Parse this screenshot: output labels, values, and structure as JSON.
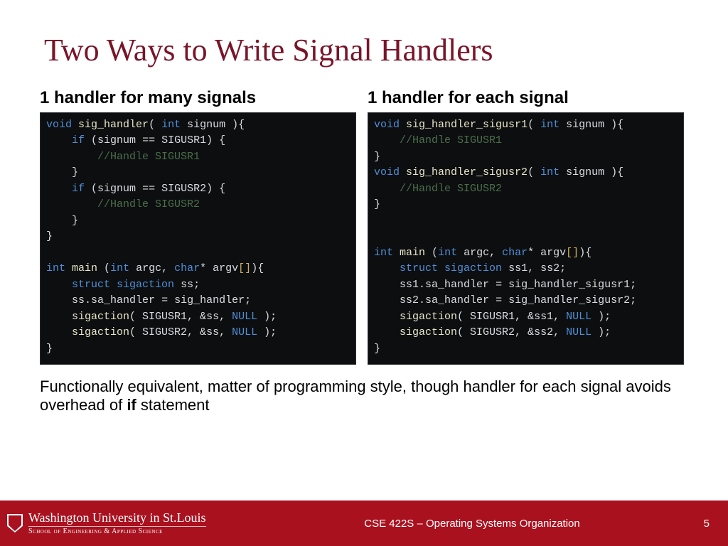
{
  "title": "Two Ways to Write Signal Handlers",
  "left": {
    "heading": "1 handler for many signals",
    "code": [
      {
        "t": "kw",
        "s": "void"
      },
      {
        "t": "pn",
        "s": " "
      },
      {
        "t": "fn",
        "s": "sig_handler"
      },
      {
        "t": "pn",
        "s": "( "
      },
      {
        "t": "kw",
        "s": "int"
      },
      {
        "t": "pn",
        "s": " "
      },
      {
        "t": "id",
        "s": "signum"
      },
      {
        "t": "pn",
        "s": " ){\n"
      },
      {
        "t": "pn",
        "s": "    "
      },
      {
        "t": "kw",
        "s": "if"
      },
      {
        "t": "pn",
        "s": " ("
      },
      {
        "t": "id",
        "s": "signum"
      },
      {
        "t": "pn",
        "s": " == SIGUSR1) {\n"
      },
      {
        "t": "pn",
        "s": "        "
      },
      {
        "t": "cm",
        "s": "//Handle SIGUSR1"
      },
      {
        "t": "pn",
        "s": "\n"
      },
      {
        "t": "pn",
        "s": "    }\n"
      },
      {
        "t": "pn",
        "s": "    "
      },
      {
        "t": "kw",
        "s": "if"
      },
      {
        "t": "pn",
        "s": " ("
      },
      {
        "t": "id",
        "s": "signum"
      },
      {
        "t": "pn",
        "s": " == SIGUSR2) {\n"
      },
      {
        "t": "pn",
        "s": "        "
      },
      {
        "t": "cm",
        "s": "//Handle SIGUSR2"
      },
      {
        "t": "pn",
        "s": "\n"
      },
      {
        "t": "pn",
        "s": "    }\n"
      },
      {
        "t": "pn",
        "s": "}\n"
      },
      {
        "t": "pn",
        "s": "\n"
      },
      {
        "t": "kw",
        "s": "int"
      },
      {
        "t": "pn",
        "s": " "
      },
      {
        "t": "fn",
        "s": "main"
      },
      {
        "t": "pn",
        "s": " ("
      },
      {
        "t": "kw",
        "s": "int"
      },
      {
        "t": "pn",
        "s": " "
      },
      {
        "t": "id",
        "s": "argc"
      },
      {
        "t": "pn",
        "s": ", "
      },
      {
        "t": "kw",
        "s": "char"
      },
      {
        "t": "pn",
        "s": "* "
      },
      {
        "t": "id",
        "s": "argv"
      },
      {
        "t": "br",
        "s": "[]"
      },
      {
        "t": "pn",
        "s": "){\n"
      },
      {
        "t": "pn",
        "s": "    "
      },
      {
        "t": "kw",
        "s": "struct"
      },
      {
        "t": "pn",
        "s": " "
      },
      {
        "t": "ty",
        "s": "sigaction"
      },
      {
        "t": "pn",
        "s": " "
      },
      {
        "t": "id",
        "s": "ss"
      },
      {
        "t": "pn",
        "s": ";\n"
      },
      {
        "t": "pn",
        "s": "    "
      },
      {
        "t": "id",
        "s": "ss"
      },
      {
        "t": "pn",
        "s": "."
      },
      {
        "t": "id",
        "s": "sa_handler"
      },
      {
        "t": "pn",
        "s": " = "
      },
      {
        "t": "id",
        "s": "sig_handler"
      },
      {
        "t": "pn",
        "s": ";\n"
      },
      {
        "t": "pn",
        "s": "    "
      },
      {
        "t": "fn",
        "s": "sigaction"
      },
      {
        "t": "pn",
        "s": "( SIGUSR1, &"
      },
      {
        "t": "id",
        "s": "ss"
      },
      {
        "t": "pn",
        "s": ", "
      },
      {
        "t": "lit",
        "s": "NULL"
      },
      {
        "t": "pn",
        "s": " );\n"
      },
      {
        "t": "pn",
        "s": "    "
      },
      {
        "t": "fn",
        "s": "sigaction"
      },
      {
        "t": "pn",
        "s": "( SIGUSR2, &"
      },
      {
        "t": "id",
        "s": "ss"
      },
      {
        "t": "pn",
        "s": ", "
      },
      {
        "t": "lit",
        "s": "NULL"
      },
      {
        "t": "pn",
        "s": " );\n"
      },
      {
        "t": "pn",
        "s": "}"
      }
    ]
  },
  "right": {
    "heading": "1 handler for each signal",
    "code": [
      {
        "t": "kw",
        "s": "void"
      },
      {
        "t": "pn",
        "s": " "
      },
      {
        "t": "fn",
        "s": "sig_handler_sigusr1"
      },
      {
        "t": "pn",
        "s": "( "
      },
      {
        "t": "kw",
        "s": "int"
      },
      {
        "t": "pn",
        "s": " "
      },
      {
        "t": "id",
        "s": "signum"
      },
      {
        "t": "pn",
        "s": " ){\n"
      },
      {
        "t": "pn",
        "s": "    "
      },
      {
        "t": "cm",
        "s": "//Handle SIGUSR1"
      },
      {
        "t": "pn",
        "s": "\n"
      },
      {
        "t": "pn",
        "s": "}\n"
      },
      {
        "t": "kw",
        "s": "void"
      },
      {
        "t": "pn",
        "s": " "
      },
      {
        "t": "fn",
        "s": "sig_handler_sigusr2"
      },
      {
        "t": "pn",
        "s": "( "
      },
      {
        "t": "kw",
        "s": "int"
      },
      {
        "t": "pn",
        "s": " "
      },
      {
        "t": "id",
        "s": "signum"
      },
      {
        "t": "pn",
        "s": " ){\n"
      },
      {
        "t": "pn",
        "s": "    "
      },
      {
        "t": "cm",
        "s": "//Handle SIGUSR2"
      },
      {
        "t": "pn",
        "s": "\n"
      },
      {
        "t": "pn",
        "s": "}\n"
      },
      {
        "t": "pn",
        "s": "\n"
      },
      {
        "t": "pn",
        "s": "\n"
      },
      {
        "t": "kw",
        "s": "int"
      },
      {
        "t": "pn",
        "s": " "
      },
      {
        "t": "fn",
        "s": "main"
      },
      {
        "t": "pn",
        "s": " ("
      },
      {
        "t": "kw",
        "s": "int"
      },
      {
        "t": "pn",
        "s": " "
      },
      {
        "t": "id",
        "s": "argc"
      },
      {
        "t": "pn",
        "s": ", "
      },
      {
        "t": "kw",
        "s": "char"
      },
      {
        "t": "pn",
        "s": "* "
      },
      {
        "t": "id",
        "s": "argv"
      },
      {
        "t": "br",
        "s": "[]"
      },
      {
        "t": "pn",
        "s": "){\n"
      },
      {
        "t": "pn",
        "s": "    "
      },
      {
        "t": "kw",
        "s": "struct"
      },
      {
        "t": "pn",
        "s": " "
      },
      {
        "t": "ty",
        "s": "sigaction"
      },
      {
        "t": "pn",
        "s": " "
      },
      {
        "t": "id",
        "s": "ss1"
      },
      {
        "t": "pn",
        "s": ", "
      },
      {
        "t": "id",
        "s": "ss2"
      },
      {
        "t": "pn",
        "s": ";\n"
      },
      {
        "t": "pn",
        "s": "    "
      },
      {
        "t": "id",
        "s": "ss1"
      },
      {
        "t": "pn",
        "s": "."
      },
      {
        "t": "id",
        "s": "sa_handler"
      },
      {
        "t": "pn",
        "s": " = "
      },
      {
        "t": "id",
        "s": "sig_handler_sigusr1"
      },
      {
        "t": "pn",
        "s": ";\n"
      },
      {
        "t": "pn",
        "s": "    "
      },
      {
        "t": "id",
        "s": "ss2"
      },
      {
        "t": "pn",
        "s": "."
      },
      {
        "t": "id",
        "s": "sa_handler"
      },
      {
        "t": "pn",
        "s": " = "
      },
      {
        "t": "id",
        "s": "sig_handler_sigusr2"
      },
      {
        "t": "pn",
        "s": ";\n"
      },
      {
        "t": "pn",
        "s": "    "
      },
      {
        "t": "fn",
        "s": "sigaction"
      },
      {
        "t": "pn",
        "s": "( SIGUSR1, &"
      },
      {
        "t": "id",
        "s": "ss1"
      },
      {
        "t": "pn",
        "s": ", "
      },
      {
        "t": "lit",
        "s": "NULL"
      },
      {
        "t": "pn",
        "s": " );\n"
      },
      {
        "t": "pn",
        "s": "    "
      },
      {
        "t": "fn",
        "s": "sigaction"
      },
      {
        "t": "pn",
        "s": "( SIGUSR2, &"
      },
      {
        "t": "id",
        "s": "ss2"
      },
      {
        "t": "pn",
        "s": ", "
      },
      {
        "t": "lit",
        "s": "NULL"
      },
      {
        "t": "pn",
        "s": " );\n"
      },
      {
        "t": "pn",
        "s": "}"
      }
    ]
  },
  "caption_pre": "Functionally equivalent, matter of programming style, though handler for each signal avoids overhead of ",
  "caption_bold": "if",
  "caption_post": " statement",
  "footer": {
    "uni_name": "Washington University in St.Louis",
    "uni_sub": "School of Engineering & Applied Science",
    "course": "CSE 422S – Operating Systems Organization",
    "page": "5"
  }
}
